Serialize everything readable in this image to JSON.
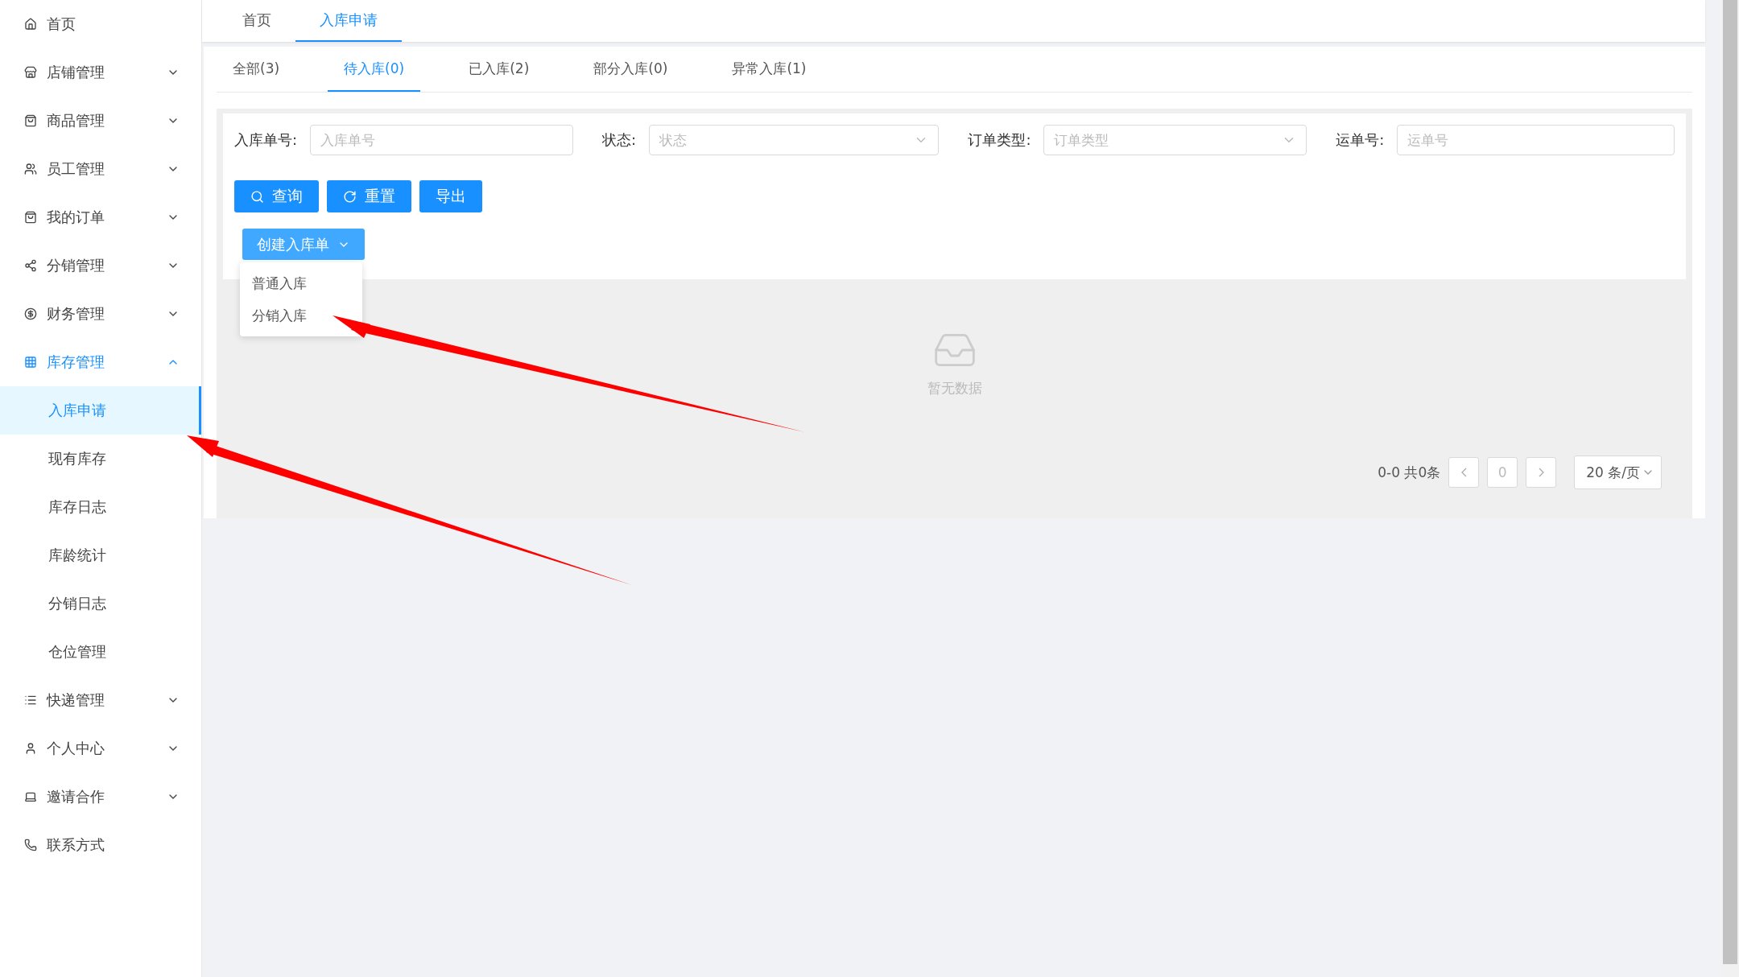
{
  "sidebar": {
    "items": [
      {
        "label": "首页",
        "kind": "link",
        "selected": false
      },
      {
        "label": "店铺管理",
        "kind": "group",
        "expanded": false,
        "selected": false
      },
      {
        "label": "商品管理",
        "kind": "group",
        "expanded": false,
        "selected": false
      },
      {
        "label": "员工管理",
        "kind": "group",
        "expanded": false,
        "selected": false
      },
      {
        "label": "我的订单",
        "kind": "group",
        "expanded": false,
        "selected": false
      },
      {
        "label": "分销管理",
        "kind": "group",
        "expanded": false,
        "selected": false
      },
      {
        "label": "财务管理",
        "kind": "group",
        "expanded": false,
        "selected": false
      },
      {
        "label": "库存管理",
        "kind": "group",
        "expanded": true,
        "selected": true,
        "children": [
          {
            "label": "入库申请",
            "selected": true
          },
          {
            "label": "现有库存",
            "selected": false
          },
          {
            "label": "库存日志",
            "selected": false
          },
          {
            "label": "库龄统计",
            "selected": false
          },
          {
            "label": "分销日志",
            "selected": false
          },
          {
            "label": "仓位管理",
            "selected": false
          }
        ]
      },
      {
        "label": "快递管理",
        "kind": "group",
        "expanded": false,
        "selected": false
      },
      {
        "label": "个人中心",
        "kind": "group",
        "expanded": false,
        "selected": false
      },
      {
        "label": "邀请合作",
        "kind": "group",
        "expanded": false,
        "selected": false
      },
      {
        "label": "联系方式",
        "kind": "link",
        "selected": false
      }
    ]
  },
  "page_tabs": [
    {
      "label": "首页",
      "selected": false
    },
    {
      "label": "入库申请",
      "selected": true
    }
  ],
  "status_tabs": [
    {
      "label": "全部(3)",
      "selected": false
    },
    {
      "label": "待入库(0)",
      "selected": true
    },
    {
      "label": "已入库(2)",
      "selected": false
    },
    {
      "label": "部分入库(0)",
      "selected": false
    },
    {
      "label": "异常入库(1)",
      "selected": false
    }
  ],
  "filters": [
    {
      "label": "入库单号:",
      "kind": "input",
      "placeholder": "入库单号"
    },
    {
      "label": "状态:",
      "kind": "select",
      "placeholder": "状态"
    },
    {
      "label": "订单类型:",
      "kind": "select",
      "placeholder": "订单类型"
    },
    {
      "label": "运单号:",
      "kind": "input",
      "placeholder": "运单号"
    }
  ],
  "buttons": [
    {
      "label": "查询",
      "kind": "search"
    },
    {
      "label": "重置",
      "kind": "reset"
    },
    {
      "label": "导出",
      "kind": "plain"
    }
  ],
  "create_menu": {
    "label": "创建入库单",
    "expanded": true,
    "options": [
      "普通入库",
      "分销入库"
    ]
  },
  "empty_text": "暂无数据",
  "pagination": {
    "summary": "0-0 共0条",
    "page": "0",
    "page_size": "20 条/页"
  }
}
